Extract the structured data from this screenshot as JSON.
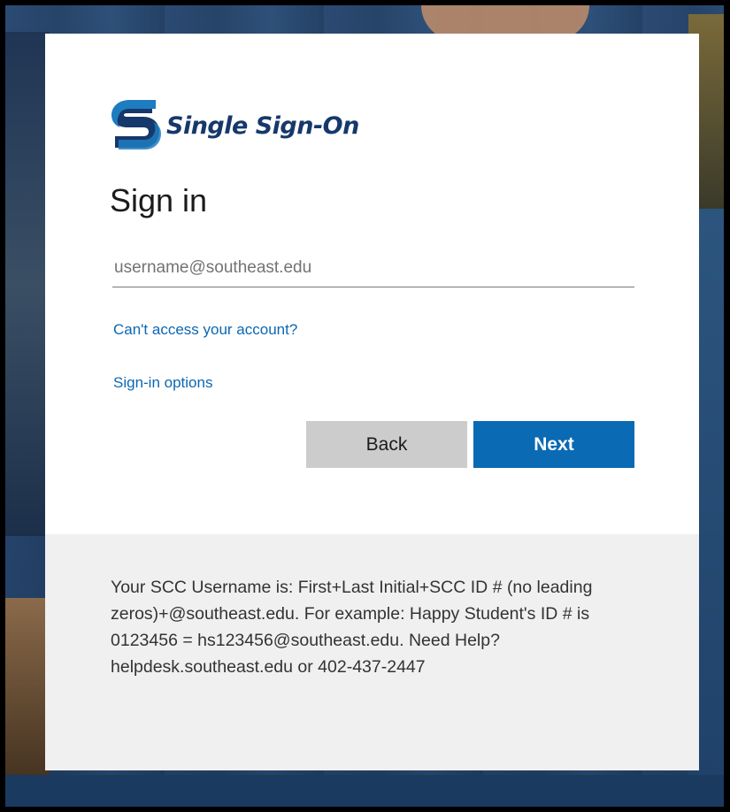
{
  "logo": {
    "text": "Single Sign-On",
    "icon": "s-logo-icon",
    "brand_color": "#16386b"
  },
  "signin": {
    "title": "Sign in",
    "username_placeholder": "username@southeast.edu",
    "username_value": "",
    "cant_access_link": "Can't access your account?",
    "options_link": "Sign-in options",
    "back_label": "Back",
    "next_label": "Next"
  },
  "footer": {
    "message": "Your SCC Username is: First+Last Initial+SCC ID # (no leading zeros)+@southeast.edu. For example: Happy Student's ID # is 0123456 = hs123456@southeast.edu. Need Help? helpdesk.southeast.edu or 402-437-2447"
  },
  "colors": {
    "accent": "#0a6ab4",
    "link": "#0b67b3",
    "back_button": "#cccccc",
    "footer_bg": "#f0f0f0"
  }
}
